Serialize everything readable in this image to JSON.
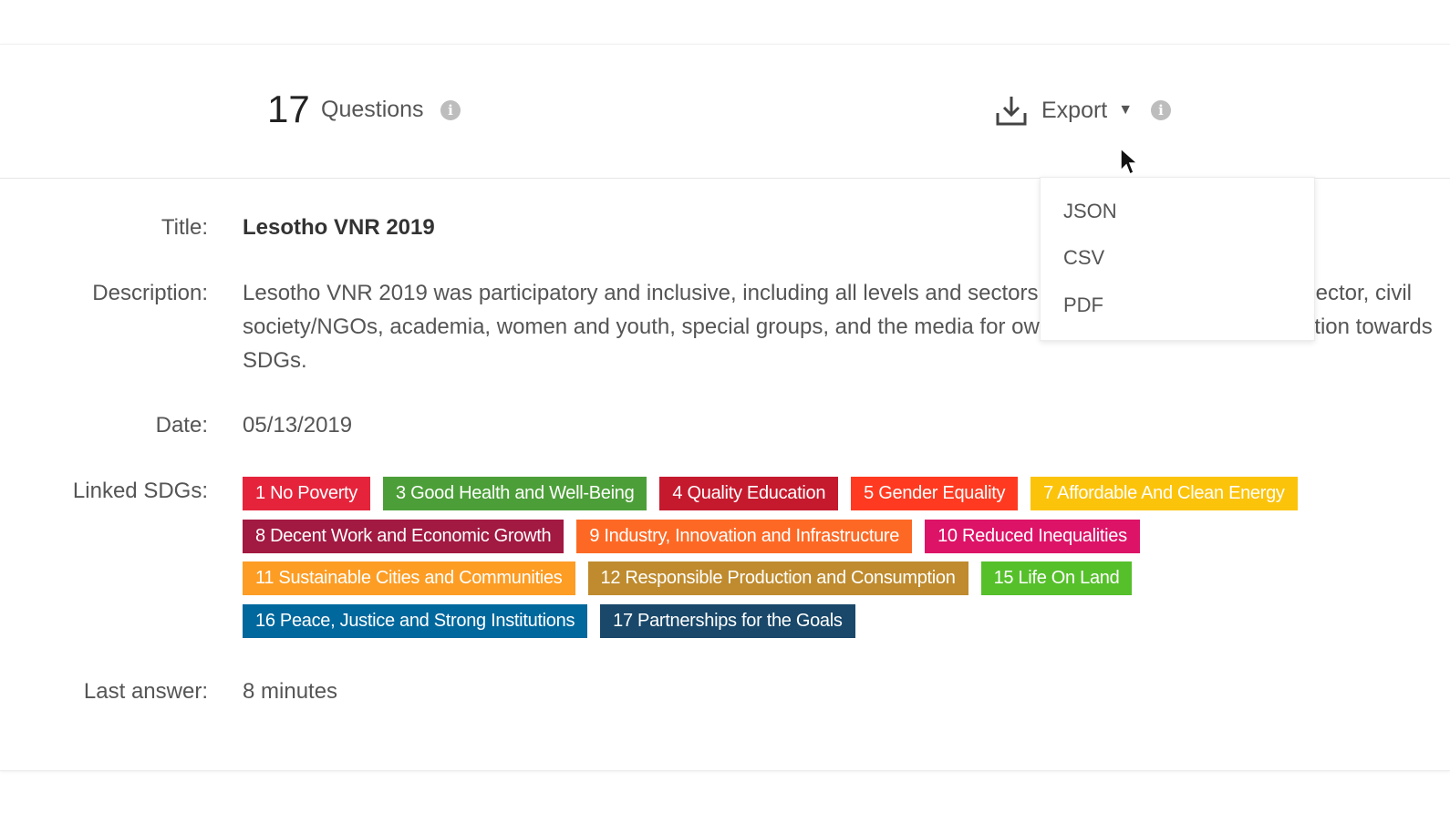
{
  "header": {
    "question_count": "17",
    "question_label": "Questions",
    "export_label": "Export",
    "export_options": [
      "JSON",
      "CSV",
      "PDF"
    ]
  },
  "details": {
    "title_label": "Title:",
    "title_value": "Lesotho VNR 2019",
    "description_label": "Description:",
    "description_value": "Lesotho VNR 2019 was participatory and inclusive, including all levels and sectors of government, the private sector, civil society/NGOs, academia, women and youth, special groups, and the media for ownership and awareness creation towards SDGs.",
    "date_label": "Date:",
    "date_value": "05/13/2019",
    "sdgs_label": "Linked SDGs:",
    "last_answer_label": "Last answer:",
    "last_answer_value": "8 minutes"
  },
  "sdg_tags": [
    [
      {
        "label": "1 No Poverty",
        "color": "#e5243b"
      },
      {
        "label": "3 Good Health and Well-Being",
        "color": "#4c9f38"
      },
      {
        "label": "4 Quality Education",
        "color": "#c5192d"
      },
      {
        "label": "5 Gender Equality",
        "color": "#ff3a21"
      },
      {
        "label": "7 Affordable And Clean Energy",
        "color": "#fcc30b"
      }
    ],
    [
      {
        "label": "8 Decent Work and Economic Growth",
        "color": "#a21942"
      },
      {
        "label": "9 Industry, Innovation and Infrastructure",
        "color": "#fd6925"
      },
      {
        "label": "10 Reduced Inequalities",
        "color": "#dd1367"
      }
    ],
    [
      {
        "label": "11 Sustainable Cities and Communities",
        "color": "#fd9d24"
      },
      {
        "label": "12 Responsible Production and Consumption",
        "color": "#bf8b2e"
      },
      {
        "label": "15 Life On Land",
        "color": "#56c02b"
      }
    ],
    [
      {
        "label": "16 Peace, Justice and Strong Institutions",
        "color": "#00689d"
      },
      {
        "label": "17 Partnerships for the Goals",
        "color": "#19486a"
      }
    ]
  ],
  "icons": {
    "info": "info-icon",
    "export": "download-icon",
    "chevron": "chevron-down-icon",
    "cursor": "mouse-pointer-icon"
  }
}
